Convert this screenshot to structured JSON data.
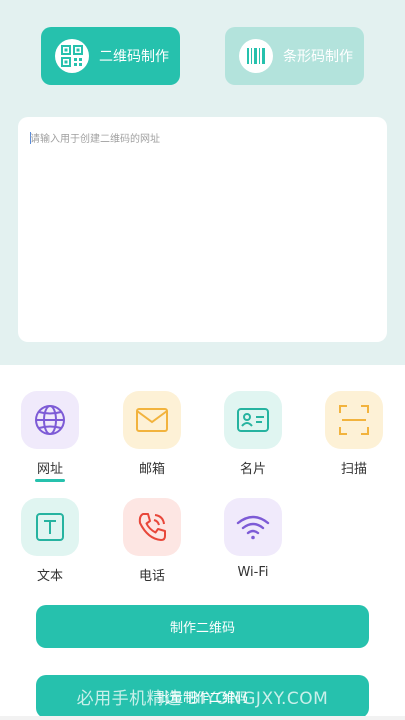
{
  "mode_tabs": {
    "qr_label": "二维码制作",
    "barcode_label": "条形码制作"
  },
  "url_input": {
    "placeholder": "请输入用于创建二维码的网址",
    "value": ""
  },
  "types": [
    {
      "label": "网址",
      "icon": "globe-icon",
      "selected": true
    },
    {
      "label": "邮箱",
      "icon": "mail-icon"
    },
    {
      "label": "名片",
      "icon": "contact-card-icon"
    },
    {
      "label": "扫描",
      "icon": "scan-icon"
    },
    {
      "label": "文本",
      "icon": "text-icon"
    },
    {
      "label": "电话",
      "icon": "phone-icon"
    },
    {
      "label": "Wi-Fi",
      "icon": "wifi-icon"
    }
  ],
  "actions": {
    "make_qr": "制作二维码",
    "batch_make_qr": "批量制作二维码"
  },
  "watermark": "必用手机精选 BIYONGJXY.COM",
  "colors": {
    "accent": "#26c1ad",
    "accent_light": "#b3e3dc",
    "top_background": "#e3f1f0"
  }
}
